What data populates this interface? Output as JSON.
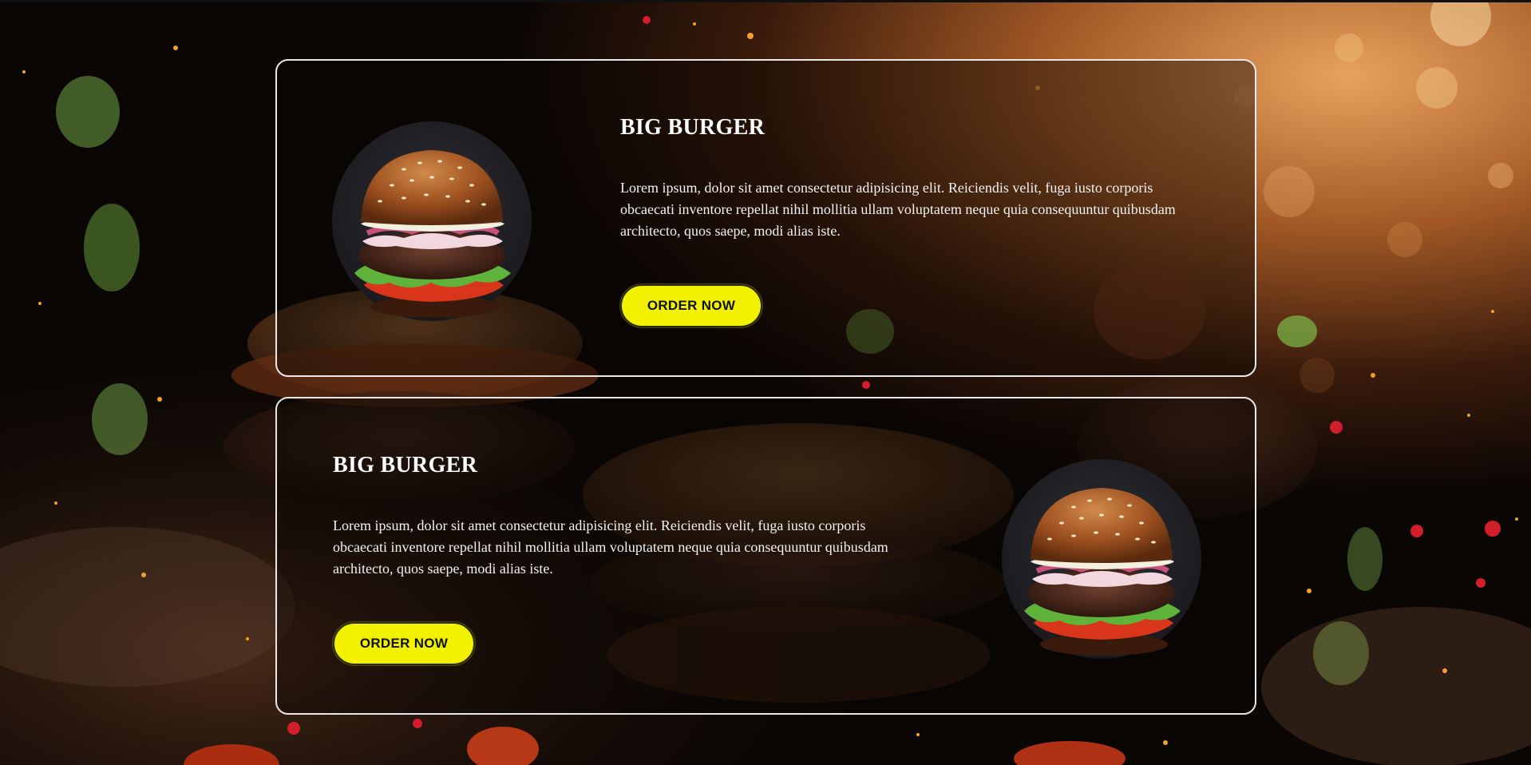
{
  "cards": [
    {
      "title": "BIG BURGER",
      "description": "Lorem ipsum, dolor sit amet consectetur adipisicing elit. Reiciendis velit, fuga iusto corporis obcaecati inventore repellat nihil mollitia ullam voluptatem neque quia consequuntur quibusdam architecto, quos saepe, modi alias iste.",
      "button_label": "ORDER NOW",
      "image_side": "left"
    },
    {
      "title": "BIG BURGER",
      "description": "Lorem ipsum, dolor sit amet consectetur adipisicing elit. Reiciendis velit, fuga iusto corporis obcaecati inventore repellat nihil mollitia ullam voluptatem neque quia consequuntur quibusdam architecto, quos saepe, modi alias iste.",
      "button_label": "ORDER NOW",
      "image_side": "right"
    }
  ],
  "colors": {
    "button_bg": "#f2f200",
    "card_border": "#e8e8e8",
    "text": "#ffffff"
  },
  "icons": {
    "burger_image": "burger-photo"
  }
}
